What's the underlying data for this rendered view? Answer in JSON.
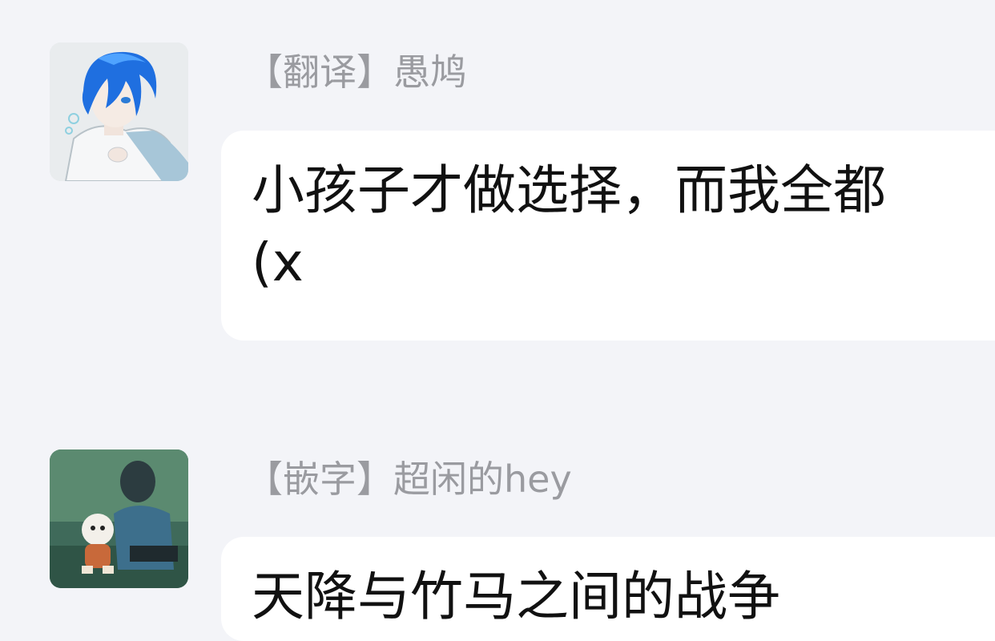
{
  "messages": [
    {
      "tag": "【翻译】",
      "name": "愚鸠",
      "text_line1": "小孩子才做选择，而我全都",
      "text_line2": "(x",
      "avatar_icon": "anime-boy-blue-hair-avatar"
    },
    {
      "tag": "【嵌字】",
      "name": "超闲的hey",
      "text_line1": "天降与竹马之间的战争",
      "avatar_icon": "anime-scene-avatar"
    }
  ],
  "colors": {
    "background": "#f3f4f8",
    "bubble": "#ffffff",
    "sender_text": "#9a9ba0",
    "message_text": "#111111"
  }
}
